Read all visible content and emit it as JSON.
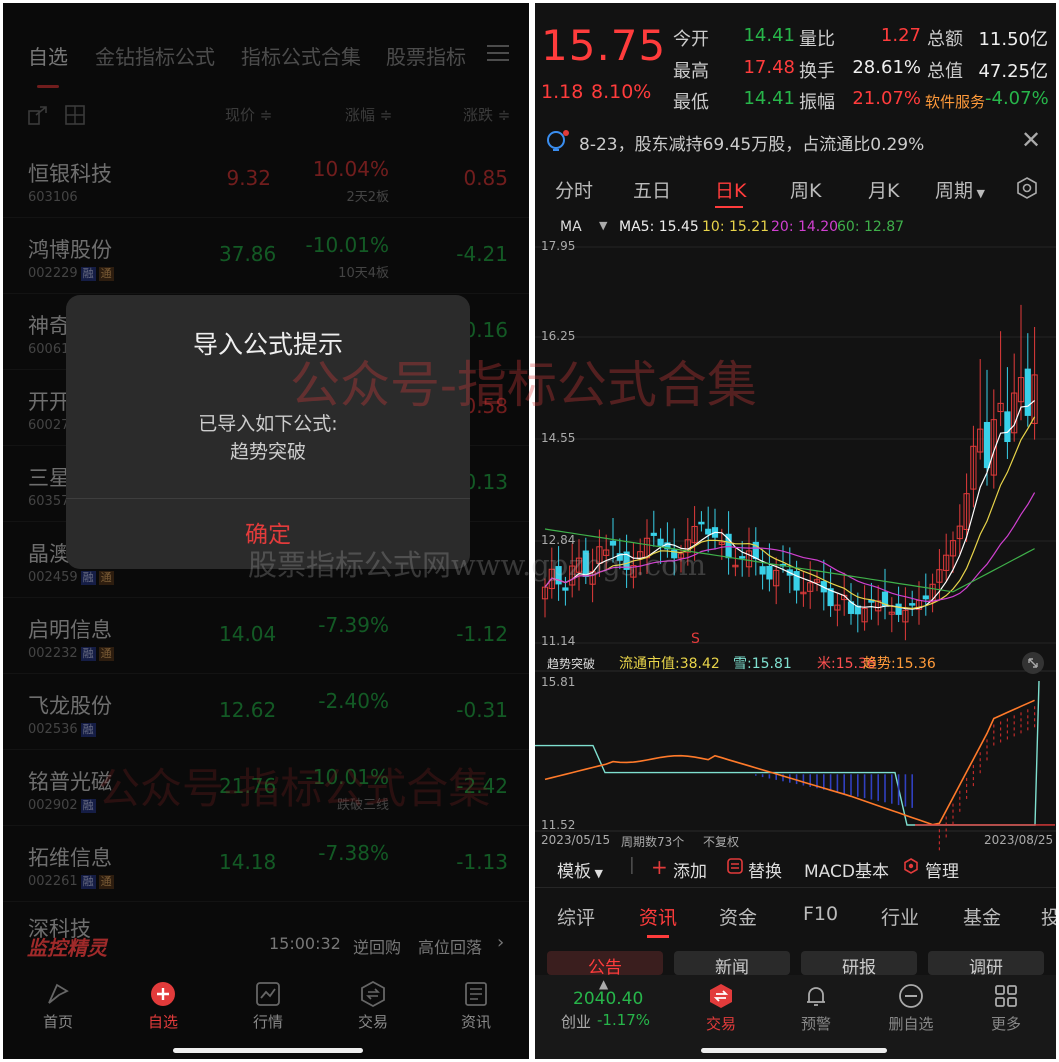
{
  "left": {
    "top_tabs": [
      "自选",
      "金钻指标公式",
      "指标公式合集",
      "股票指标"
    ],
    "columns": {
      "price": "现价 ≑",
      "pct": "涨幅 ≑",
      "chg": "涨跌 ≑"
    },
    "rows": [
      {
        "name": "恒银科技",
        "code": "603106",
        "tags": [],
        "price": "9.32",
        "pct": "10.04%",
        "sub": "2天2板",
        "chg": "0.85",
        "dir": "up"
      },
      {
        "name": "鸿博股份",
        "code": "002229",
        "tags": [
          "融",
          "通"
        ],
        "price": "37.86",
        "pct": "-10.01%",
        "sub": "10天4板",
        "chg": "-4.21",
        "dir": "down"
      },
      {
        "name": "神奇",
        "code": "60061",
        "tags": [],
        "price": "",
        "pct": "",
        "sub": "",
        "chg": "0.16",
        "dir": "down"
      },
      {
        "name": "开开",
        "code": "60027",
        "tags": [],
        "price": "",
        "pct": "",
        "sub": "",
        "chg": "0.58",
        "dir": "up"
      },
      {
        "name": "三星",
        "code": "60357",
        "tags": [],
        "price": "",
        "pct": "",
        "sub": "",
        "chg": "0.13",
        "dir": "down"
      },
      {
        "name": "晶澳",
        "code": "002459",
        "tags": [
          "融",
          "通"
        ],
        "price": "",
        "pct": "",
        "sub": "",
        "chg": "",
        "dir": "down"
      },
      {
        "name": "启明信息",
        "code": "002232",
        "tags": [
          "融",
          "通"
        ],
        "price": "14.04",
        "pct": "-7.39%",
        "sub": "",
        "chg": "-1.12",
        "dir": "down"
      },
      {
        "name": "飞龙股份",
        "code": "002536",
        "tags": [
          "融"
        ],
        "price": "12.62",
        "pct": "-2.40%",
        "sub": "",
        "chg": "-0.31",
        "dir": "down"
      },
      {
        "name": "铭普光磁",
        "code": "002902",
        "tags": [
          "融"
        ],
        "price": "21.76",
        "pct": "-10.01%",
        "sub": "跌破三线",
        "chg": "-2.42",
        "dir": "down"
      },
      {
        "name": "拓维信息",
        "code": "002261",
        "tags": [
          "融",
          "通"
        ],
        "price": "14.18",
        "pct": "-7.38%",
        "sub": "",
        "chg": "-1.13",
        "dir": "down"
      }
    ],
    "partial_row": "深科技",
    "dialog": {
      "title": "导入公式提示",
      "line1": "已导入如下公式:",
      "line2": "趋势突破",
      "confirm": "确定"
    },
    "monitor": {
      "title": "监控精灵",
      "time": "15:00:32",
      "item1": "逆回购",
      "item2": "高位回落"
    },
    "nav": [
      "首页",
      "自选",
      "行情",
      "交易",
      "资讯"
    ]
  },
  "watermarks": {
    "wm1": "公众号-指标公式合集",
    "wm2": "股票指标公式网www.gpzbgs.com",
    "wm3": "公众号-指标公式合集"
  },
  "right": {
    "price": "15.75",
    "change": "1.18",
    "change_pct": "8.10%",
    "quote": [
      {
        "label": "今开",
        "value": "14.41",
        "color": "green"
      },
      {
        "label": "量比",
        "value": "1.27",
        "color": "red"
      },
      {
        "label": "总额",
        "value": "11.50亿",
        "color": "white"
      },
      {
        "label": "最高",
        "value": "17.48",
        "color": "red"
      },
      {
        "label": "换手",
        "value": "28.61%",
        "color": "white"
      },
      {
        "label": "总值",
        "value": "47.25亿",
        "color": "white"
      },
      {
        "label": "最低",
        "value": "14.41",
        "color": "green"
      },
      {
        "label": "振幅",
        "value": "21.07%",
        "color": "red"
      },
      {
        "label": "软件服务",
        "value": "-4.07%",
        "color": "green"
      }
    ],
    "notice": "8-23，股东减持69.45万股，占流通比0.29%",
    "periods": [
      "分时",
      "五日",
      "日K",
      "周K",
      "月K",
      "周期"
    ],
    "ma": {
      "label": "MA",
      "ma5": "MA5: 15.45",
      "ma10": "10: 15.21",
      "ma20": "20: 14.20",
      "ma60": "60: 12.87"
    },
    "price_axis": [
      "17.95",
      "16.25",
      "14.55",
      "12.84",
      "11.14"
    ],
    "s_marker": "S",
    "indicator": {
      "name": "趋势突破",
      "v1": "流通市值:38.42",
      "v2": "雪:15.81",
      "v3": "米:15.36",
      "v4": "趋势:15.36",
      "top": "15.81",
      "bottom": "11.52"
    },
    "date_start": "2023/05/15",
    "period_count": "周期数73个",
    "adjust": "不复权",
    "date_end": "2023/08/25",
    "tools": [
      "模板",
      "添加",
      "替换",
      "MACD基本",
      "管理"
    ],
    "info_tabs": [
      "综评",
      "资讯",
      "资金",
      "F10",
      "行业",
      "基金",
      "投"
    ],
    "chips": [
      "公告",
      "新闻",
      "研报",
      "调研"
    ],
    "index": {
      "value": "2040.40",
      "name": "创业",
      "pct": "-1.17%"
    },
    "bottom_nav": [
      "交易",
      "预警",
      "删自选",
      "更多"
    ]
  },
  "colors": {
    "up": "#e23b3b",
    "down": "#27b54a",
    "accent": "#ff3c3c",
    "ma5": "#ffffff",
    "ma10": "#e8d44a",
    "ma20": "#d040d0",
    "ma60": "#3fb04a"
  },
  "chart_data": {
    "type": "candlestick",
    "x_range": [
      "2023/05/15",
      "2023/08/25"
    ],
    "ylim": [
      11.14,
      17.95
    ],
    "indicator_ylim": [
      11.52,
      15.81
    ]
  }
}
